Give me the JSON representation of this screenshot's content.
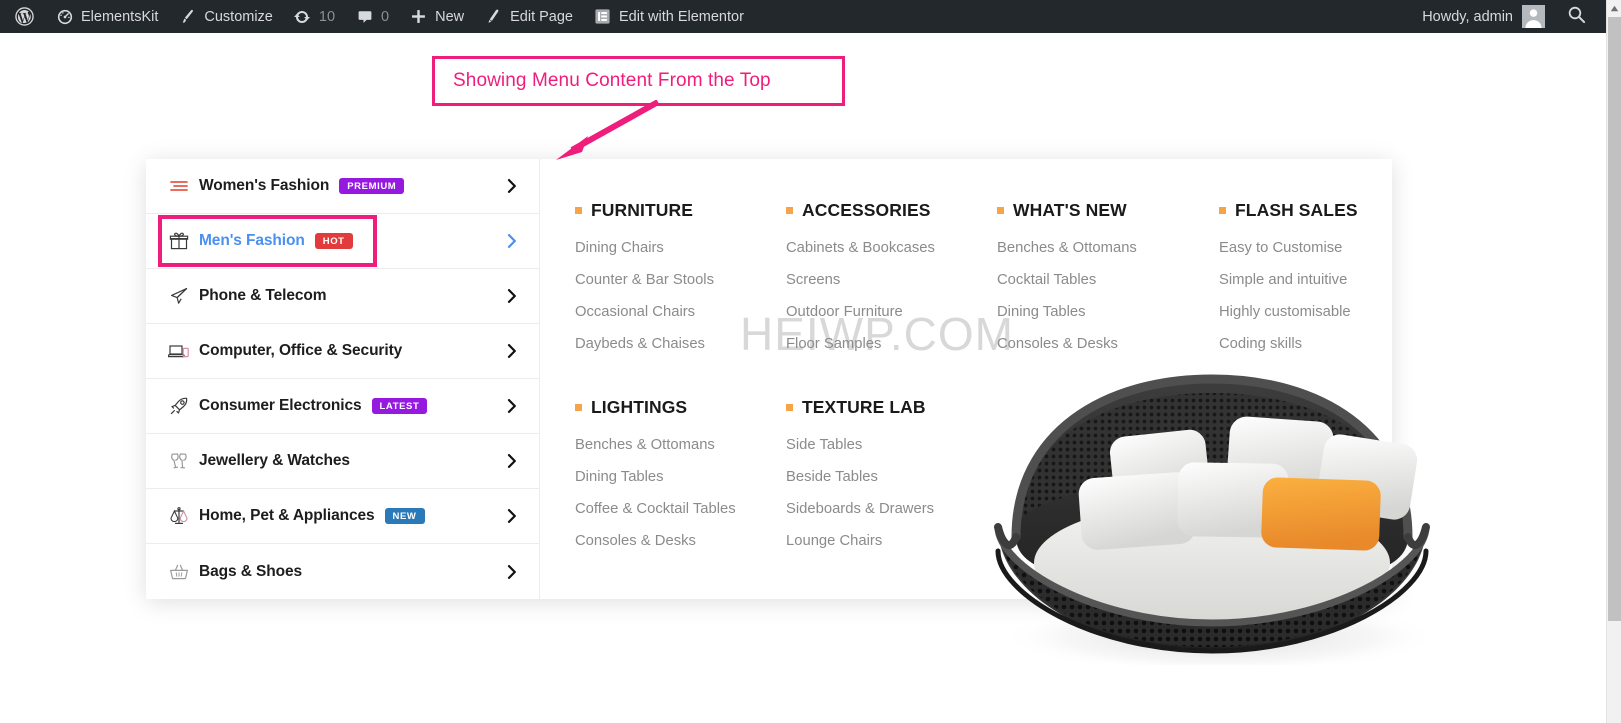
{
  "adminbar": {
    "items": [
      {
        "id": "wp-logo",
        "icon": "wordpress-icon",
        "label": ""
      },
      {
        "id": "elementskit",
        "icon": "dashboard-icon",
        "label": "ElementsKit"
      },
      {
        "id": "customize",
        "icon": "paintbrush-icon",
        "label": "Customize"
      },
      {
        "id": "updates",
        "icon": "update-icon",
        "label": "10"
      },
      {
        "id": "comments",
        "icon": "comment-icon",
        "label": "0"
      },
      {
        "id": "new",
        "icon": "plus-icon",
        "label": "New"
      },
      {
        "id": "edit-page",
        "icon": "pencil-icon",
        "label": "Edit Page"
      },
      {
        "id": "edit-elementor",
        "icon": "elementor-icon",
        "label": "Edit with Elementor"
      }
    ],
    "howdy": "Howdy, admin",
    "search_icon": "search-icon",
    "avatar_icon": "avatar-icon"
  },
  "annotation": {
    "text": "Showing Menu Content From the Top",
    "color": "#ef1d7c"
  },
  "categories": [
    {
      "label": "Women's Fashion",
      "icon": "menu-lines-icon",
      "badge": "PREMIUM",
      "badge_type": "premium",
      "active": false
    },
    {
      "label": "Men's Fashion",
      "icon": "gift-icon",
      "badge": "HOT",
      "badge_type": "hot",
      "active": true
    },
    {
      "label": "Phone & Telecom",
      "icon": "paper-plane-icon",
      "badge": "",
      "badge_type": "",
      "active": false
    },
    {
      "label": "Computer, Office & Security",
      "icon": "laptop-icon",
      "badge": "",
      "badge_type": "",
      "active": false
    },
    {
      "label": "Consumer Electronics",
      "icon": "rocket-icon",
      "badge": "LATEST",
      "badge_type": "latest",
      "active": false
    },
    {
      "label": "Jewellery & Watches",
      "icon": "champagne-glasses-icon",
      "badge": "",
      "badge_type": "",
      "active": false
    },
    {
      "label": "Home, Pet & Appliances",
      "icon": "scales-icon",
      "badge": "NEW",
      "badge_type": "new",
      "active": false
    },
    {
      "label": "Bags & Shoes",
      "icon": "basket-icon",
      "badge": "",
      "badge_type": "",
      "active": false
    }
  ],
  "mega_menu": {
    "columns": [
      {
        "title": "FURNITURE",
        "links": [
          "Dining Chairs",
          "Counter & Bar Stools",
          "Occasional Chairs",
          "Daybeds & Chaises"
        ]
      },
      {
        "title": "ACCESSORIES",
        "links": [
          "Cabinets & Bookcases",
          "Screens",
          "Outdoor Furniture",
          "Floor Samples"
        ]
      },
      {
        "title": "WHAT'S NEW",
        "links": [
          "Benches & Ottomans",
          "Cocktail Tables",
          "Dining Tables",
          "Consoles & Desks"
        ]
      },
      {
        "title": "FLASH SALES",
        "links": [
          "Easy to Customise",
          "Simple and intuitive",
          "Highly customisable",
          "Coding skills"
        ]
      },
      {
        "title": "LIGHTINGS",
        "links": [
          "Benches & Ottomans",
          "Dining Tables",
          "Coffee & Cocktail Tables",
          "Consoles & Desks"
        ]
      },
      {
        "title": "TEXTURE LAB",
        "links": [
          "Side Tables",
          "Beside Tables",
          "Sideboards & Drawers",
          "Lounge Chairs"
        ]
      }
    ],
    "bullet_color": "#f5a44a",
    "product_image": "rattan-daybed-sofa"
  },
  "watermark": {
    "text": "HEIWP.COM"
  },
  "colors": {
    "admin_bar_bg": "#23282d",
    "accent_pink": "#ef1d7c",
    "active_blue": "#4a90f0",
    "bullet_orange": "#f5a44a",
    "badge_purple": "#9619e0",
    "badge_red": "#e23b3b",
    "badge_blue": "#2a7ab9"
  }
}
